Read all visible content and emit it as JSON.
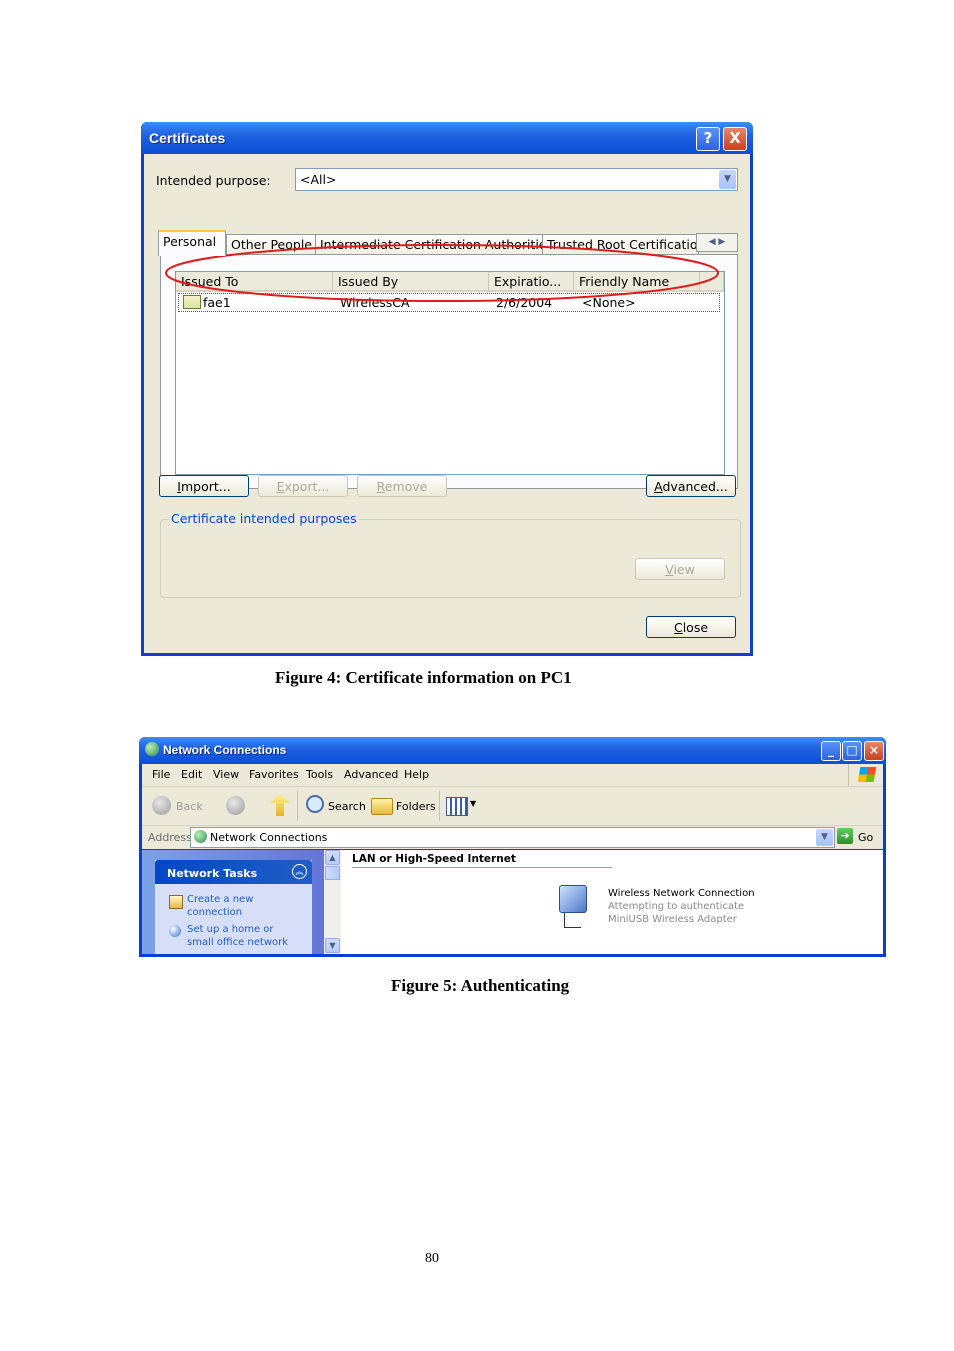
{
  "cert_dialog": {
    "title": "Certificates",
    "help_button": "?",
    "close_x": "X",
    "intended_purpose_label": "Intended purpose:",
    "intended_purpose_value": "<All>",
    "tabs": [
      "Personal",
      "Other People",
      "Intermediate Certification Authorities",
      "Trusted Root Certification"
    ],
    "columns": [
      "Issued To",
      "Issued By",
      "Expiratio...",
      "Friendly Name"
    ],
    "rows": [
      {
        "issued_to": "fae1",
        "issued_by": "WirelessCA",
        "expiration": "2/6/2004",
        "friendly_name": "<None>"
      }
    ],
    "buttons": {
      "import": "Import...",
      "export": "Export...",
      "remove": "Remove",
      "advanced": "Advanced...",
      "view": "View",
      "close": "Close"
    },
    "group_label": "Certificate intended purposes",
    "highlight_color": "#e01b1b"
  },
  "caption1": "Figure 4: Certificate information on PC1",
  "net_window": {
    "title": "Network Connections",
    "menu": [
      "File",
      "Edit",
      "View",
      "Favorites",
      "Tools",
      "Advanced",
      "Help"
    ],
    "toolbar": {
      "back": "Back",
      "search": "Search",
      "folders": "Folders"
    },
    "address_label": "Address",
    "address_value": "Network Connections",
    "go": "Go",
    "tasks_header": "Network Tasks",
    "tasks": [
      "Create a new connection",
      "Set up a home or small office network"
    ],
    "section_header": "LAN or High-Speed Internet",
    "connection": {
      "name": "Wireless Network Connection",
      "status": "Attempting to authenticate",
      "device": "MiniUSB Wireless Adapter"
    }
  },
  "caption2": "Figure 5: Authenticating",
  "page_number": "80"
}
